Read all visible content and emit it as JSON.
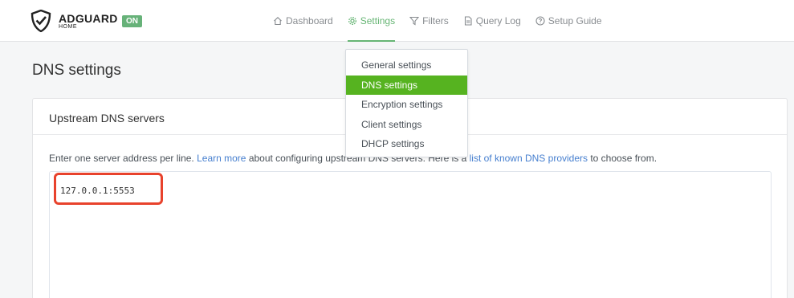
{
  "brand": {
    "name": "ADGUARD",
    "subtitle": "HOME",
    "status_badge": "ON",
    "shield_icon": "adguard-shield-icon"
  },
  "nav": {
    "items": [
      {
        "label": "Dashboard",
        "icon": "home-icon"
      },
      {
        "label": "Settings",
        "icon": "gear-icon",
        "active": true
      },
      {
        "label": "Filters",
        "icon": "filter-icon"
      },
      {
        "label": "Query Log",
        "icon": "document-icon"
      },
      {
        "label": "Setup Guide",
        "icon": "help-circle-icon"
      }
    ]
  },
  "settings_menu": {
    "items": [
      {
        "label": "General settings"
      },
      {
        "label": "DNS settings",
        "active": true
      },
      {
        "label": "Encryption settings"
      },
      {
        "label": "Client settings"
      },
      {
        "label": "DHCP settings"
      }
    ]
  },
  "page": {
    "title": "DNS settings"
  },
  "upstream": {
    "title": "Upstream DNS servers",
    "desc_part1": "Enter one server address per line. ",
    "learn_more": "Learn more",
    "desc_part2": " about configuring upstream DNS servers. Here is a ",
    "providers_link": "list of known DNS providers",
    "desc_part3": " to choose from.",
    "servers_value": "127.0.0.1:5553"
  },
  "colors": {
    "accent": "#66b574",
    "menu_active": "#56b320",
    "link": "#467fcf",
    "annotation": "#e8422c"
  }
}
